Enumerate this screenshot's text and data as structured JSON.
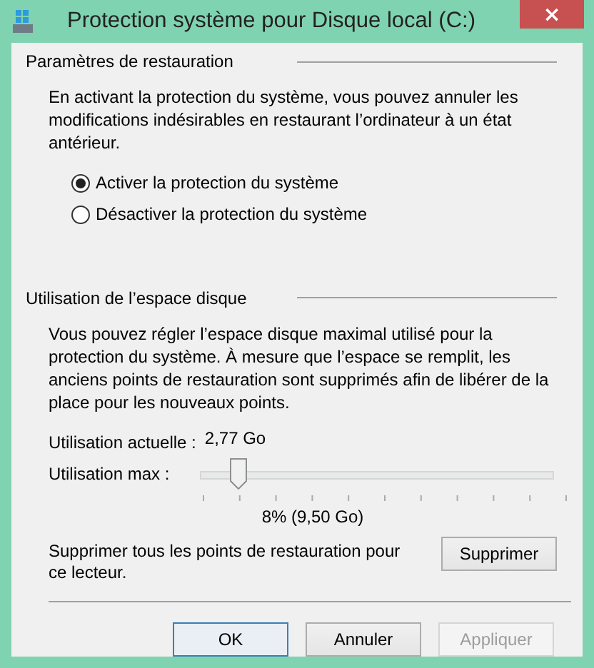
{
  "window": {
    "title": "Protection système pour Disque local (C:)",
    "close": "×"
  },
  "restore_settings": {
    "header": "Paramètres de restauration",
    "description": "En activant la protection du système, vous pouvez annuler les modifications indésirables en restaurant l’ordinateur à un état antérieur.",
    "options": [
      {
        "label": "Activer la protection du système",
        "selected": true
      },
      {
        "label": "Désactiver la protection du système",
        "selected": false
      }
    ]
  },
  "disk_usage": {
    "header": "Utilisation de l’espace disque",
    "description": "Vous pouvez régler l’espace disque maximal utilisé pour la protection du système. À mesure que l’espace se remplit, les anciens points de restauration sont supprimés afin de libérer de la place pour les nouveaux points.",
    "current_label": "Utilisation actuelle :",
    "current_value": "2,77 Go",
    "max_label": "Utilisation max :",
    "max_slider": {
      "level": 0.08
    },
    "max_reading": "8% (9,50 Go)",
    "delete_text": "Supprimer tous les points de restauration pour ce lecteur.",
    "delete_button": "Supprimer"
  },
  "buttons": [
    {
      "label": "OK",
      "kind": "default",
      "disabled": false
    },
    {
      "label": "Annuler",
      "kind": "normal",
      "disabled": false
    },
    {
      "label": "Appliquer",
      "kind": "normal",
      "disabled": true
    }
  ]
}
